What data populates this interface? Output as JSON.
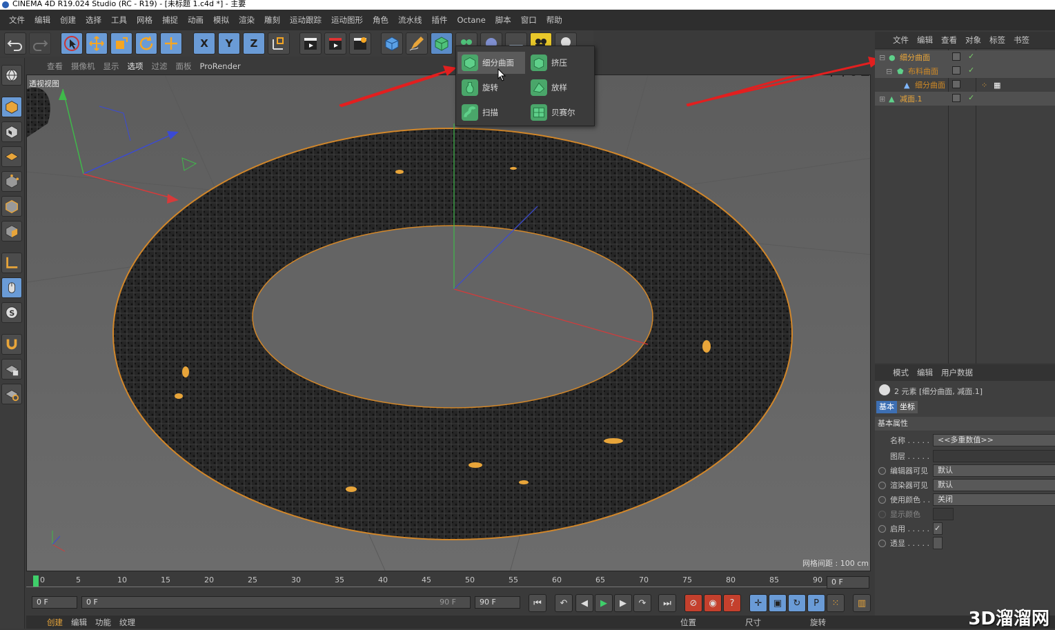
{
  "title": "CINEMA 4D R19.024 Studio (RC - R19) - [未标题 1.c4d *] - 主要",
  "menubar": [
    "文件",
    "编辑",
    "创建",
    "选择",
    "工具",
    "网格",
    "捕捉",
    "动画",
    "模拟",
    "渲染",
    "雕刻",
    "运动跟踪",
    "运动图形",
    "角色",
    "流水线",
    "插件",
    "Octane",
    "脚本",
    "窗口",
    "帮助"
  ],
  "toolbar": {
    "axis_x": "X",
    "axis_y": "Y",
    "axis_z": "Z"
  },
  "viewport_menu": [
    "查看",
    "摄像机",
    "显示",
    "选项",
    "过滤",
    "面板",
    "ProRender"
  ],
  "viewport_active": "选项",
  "viewport_label": "透视视图",
  "grid_label": "网格间距 : 100 cm",
  "flyout": {
    "items": [
      {
        "label": "细分曲面",
        "icon": "subdivision-surface-icon"
      },
      {
        "label": "挤压",
        "icon": "extrude-icon"
      },
      {
        "label": "旋转",
        "icon": "lathe-icon"
      },
      {
        "label": "放样",
        "icon": "loft-icon"
      },
      {
        "label": "扫描",
        "icon": "sweep-icon"
      },
      {
        "label": "贝赛尔",
        "icon": "bezier-icon"
      }
    ]
  },
  "object_manager": {
    "menu": [
      "文件",
      "编辑",
      "查看",
      "对象",
      "标签",
      "书签"
    ],
    "rows": [
      {
        "name": "细分曲面",
        "indent": 0
      },
      {
        "name": "布料曲面",
        "indent": 1
      },
      {
        "name": "细分曲面",
        "indent": 2
      },
      {
        "name": "减面.1",
        "indent": 0
      }
    ]
  },
  "attributes": {
    "menu": [
      "模式",
      "编辑",
      "用户数据"
    ],
    "summary": "2 元素 [细分曲面, 减面.1]",
    "tabs": [
      "基本",
      "坐标"
    ],
    "section": "基本属性",
    "fields": [
      {
        "label": "名称 . . . . .",
        "value": "<<多重数值>>"
      },
      {
        "label": "图层 . . . . .",
        "value": ""
      },
      {
        "label": "编辑器可见",
        "value": "默认"
      },
      {
        "label": "渲染器可见",
        "value": "默认"
      },
      {
        "label": "使用颜色 . .",
        "value": "关闭"
      },
      {
        "label": "显示颜色",
        "value": ""
      },
      {
        "label": "启用 . . . . .",
        "value": "✓"
      },
      {
        "label": "透显 . . . . .",
        "value": ""
      }
    ]
  },
  "timeline": {
    "ticks": [
      "0",
      "5",
      "10",
      "15",
      "20",
      "25",
      "30",
      "35",
      "40",
      "45",
      "50",
      "55",
      "60",
      "65",
      "70",
      "75",
      "80",
      "85",
      "90"
    ],
    "current_frame_field": "0 F"
  },
  "playbar": {
    "start": "0 F",
    "range_start": "0 F",
    "range_end": "90 F",
    "end": "90 F"
  },
  "bottom_menu": [
    "创建",
    "编辑",
    "功能",
    "纹理"
  ],
  "coords_bar": [
    "位置",
    "尺寸",
    "旋转"
  ],
  "watermark": "3D溜溜网"
}
